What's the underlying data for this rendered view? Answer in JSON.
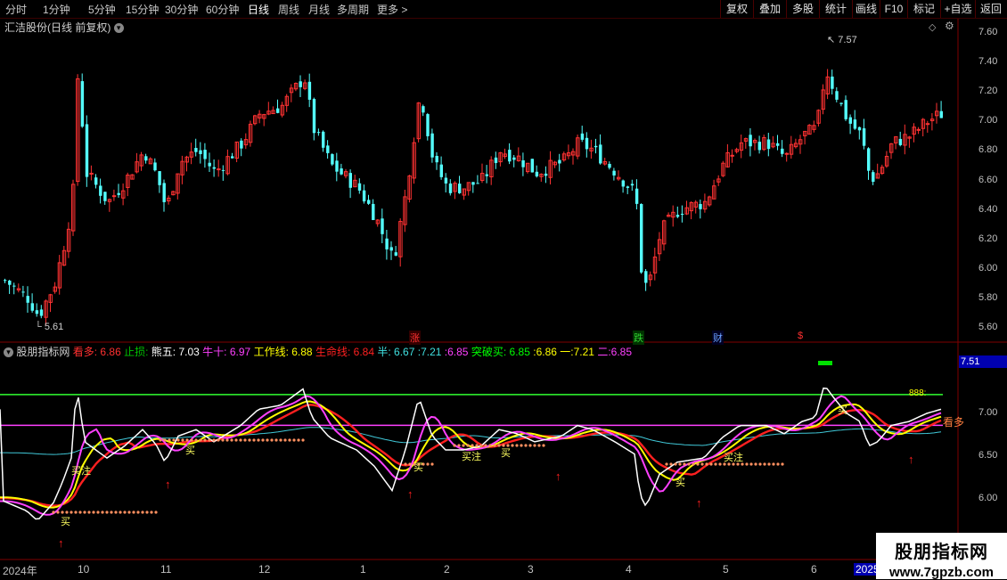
{
  "toolbar": {
    "periods": [
      "分时",
      "1分钟",
      "5分钟",
      "15分钟",
      "30分钟",
      "60分钟",
      "日线",
      "周线",
      "月线",
      "多周期",
      "更多 >"
    ],
    "active_period": "日线",
    "right_buttons": [
      "复权",
      "叠加",
      "多股",
      "统计",
      "画线",
      "F10",
      "标记",
      "+自选",
      "返回"
    ]
  },
  "main_chart": {
    "title": "汇洁股份(日线 前复权)",
    "high_label": "7.57",
    "low_label": "5.61",
    "yticks": [
      "7.60",
      "7.40",
      "7.20",
      "7.00",
      "6.80",
      "6.60",
      "6.40",
      "6.20",
      "6.00",
      "5.80",
      "5.60"
    ],
    "event_marks": [
      {
        "text": "涨",
        "color": "#ff3030"
      },
      {
        "text": "跌",
        "color": "#30d030"
      },
      {
        "text": "财",
        "color": "#6aa0ff"
      },
      {
        "text": "$",
        "color": "#ff3030"
      }
    ],
    "colors": {
      "up": "#ff3232",
      "down": "#54ffff"
    }
  },
  "indicator": {
    "name": "股朋指标网",
    "values": [
      {
        "label": "看多:",
        "value": "6.86",
        "color": "#ff3030"
      },
      {
        "label": "止损:",
        "value": "",
        "color": "#00c000"
      },
      {
        "label": "熊五:",
        "value": "7.03",
        "color": "#ffffff"
      },
      {
        "label": "牛十:",
        "value": "6.97",
        "color": "#ff40ff"
      },
      {
        "label": "工作线:",
        "value": "6.88",
        "color": "#ffff00"
      },
      {
        "label": "生命线:",
        "value": "6.84",
        "color": "#ff2020"
      },
      {
        "label": "半:",
        "value": "6.67",
        "color": "#40e0e0"
      },
      {
        "label": ":",
        "value": "7.21",
        "color": "#40e0e0"
      },
      {
        "label": ":",
        "value": "6.85",
        "color": "#ff40ff"
      },
      {
        "label": "突破买:",
        "value": "6.85",
        "color": "#00ff00"
      },
      {
        "label": ":",
        "value": "6.86",
        "color": "#ffff00"
      },
      {
        "label": "一:",
        "value": "7.21",
        "color": "#ffff00"
      },
      {
        "label": "二:",
        "value": "6.85",
        "color": "#ff40ff"
      }
    ],
    "current_value_box": "7.51",
    "yticks": [
      "7.00",
      "6.50",
      "6.00"
    ],
    "level_888": "888:",
    "buy_labels": [
      "买",
      "买注",
      "买",
      "买",
      "买注",
      "买",
      "买",
      "买注",
      "买"
    ],
    "kanduo": "看多"
  },
  "x_axis": {
    "labels": [
      "2024年",
      "10",
      "11",
      "12",
      "1",
      "2",
      "3",
      "4",
      "5",
      "6",
      "2025"
    ]
  },
  "watermark": {
    "title": "股朋指标网",
    "url": "www.7gpzb.com"
  }
}
